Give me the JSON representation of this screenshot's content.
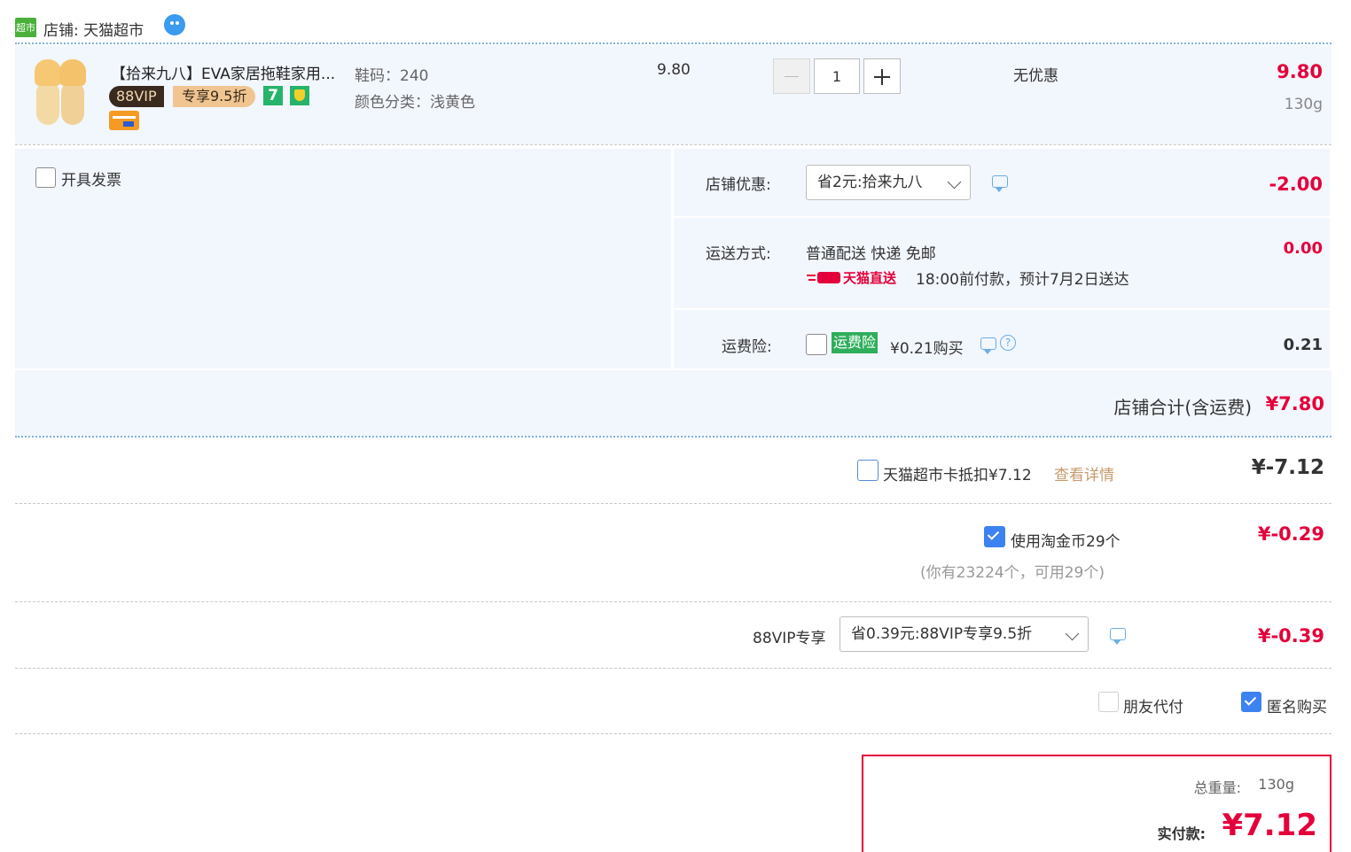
{
  "shop": {
    "label": "店铺: 天猫超市",
    "badge": "超市"
  },
  "item": {
    "title": "【拾来九八】EVA家居拖鞋家用...",
    "vip_tag": "88VIP",
    "vip_discount": "专享9.5折",
    "badge_7": "7",
    "sku_size": "鞋码：240",
    "sku_color": "颜色分类：浅黄色",
    "unit_price": "9.80",
    "quantity": "1",
    "discount": "无优惠",
    "subtotal": "9.80",
    "weight": "130g"
  },
  "invoice": {
    "label": "开具发票"
  },
  "shop_coupon": {
    "label": "店铺优惠:",
    "selected": "省2元:拾来九八",
    "amount": "-2.00"
  },
  "shipping": {
    "label": "运送方式:",
    "method": "普通配送 快递 免邮",
    "brand": "天猫直送",
    "eta": "18:00前付款，预计7月2日送达",
    "amount": "0.00"
  },
  "insurance": {
    "label": "运费险:",
    "tag": "运费险",
    "price": "¥0.21购买",
    "amount": "0.21"
  },
  "shop_total": {
    "label": "店铺合计(含运费)",
    "amount": "¥7.80"
  },
  "card_deduct": {
    "label": "天猫超市卡抵扣¥7.12",
    "link": "查看详情",
    "amount": "¥-7.12"
  },
  "coins": {
    "label": "使用淘金币29个",
    "note": "(你有23224个，可用29个)",
    "amount": "¥-0.29"
  },
  "vip": {
    "label": "88VIP专享",
    "selected": "省0.39元:88VIP专享9.5折",
    "amount": "¥-0.39"
  },
  "options": {
    "friend_pay": "朋友代付",
    "anonymous": "匿名购买"
  },
  "summary": {
    "weight_label": "总重量:",
    "weight_value": "130g",
    "pay_label": "实付款:",
    "pay_amount": "¥7.12"
  },
  "colors": {
    "accent_red": "#e4003a",
    "panel_bg": "#f2f6fd",
    "check_blue": "#3c82f0",
    "tmall_green": "#4bb03b"
  }
}
